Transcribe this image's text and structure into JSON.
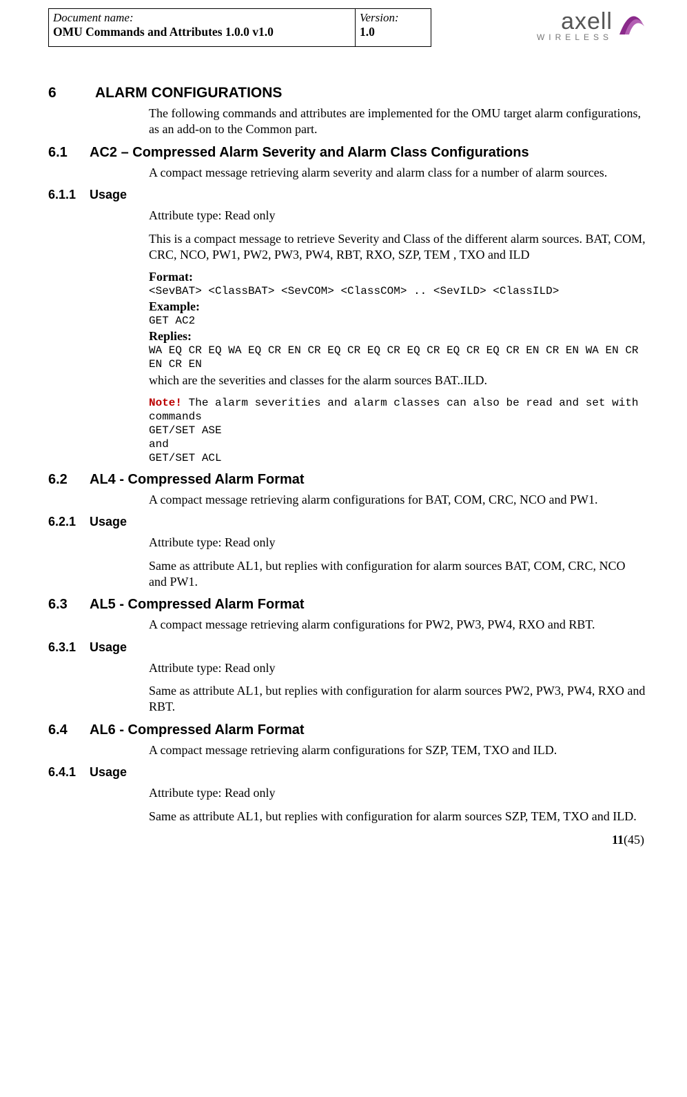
{
  "header": {
    "docLabel": "Document name:",
    "docValue": "OMU Commands and Attributes 1.0.0 v1.0",
    "verLabel": "Version:",
    "verValue": "1.0",
    "logoBrand": "axell",
    "logoSub": "WIRELESS"
  },
  "s6": {
    "num": "6",
    "title": "ALARM CONFIGURATIONS",
    "intro": "The following commands and attributes are implemented for the OMU target alarm configurations, as an add-on to the Common part."
  },
  "s61": {
    "num": "6.1",
    "title": "AC2 – Compressed Alarm Severity and Alarm Class Configurations",
    "intro": "A compact message retrieving alarm severity and alarm class for a number of alarm sources."
  },
  "s611": {
    "num": "6.1.1",
    "title": "Usage",
    "attr": "Attribute type: Read only",
    "desc": "This is a compact message to retrieve Severity and Class of the different alarm sources. BAT, COM, CRC, NCO, PW1, PW2, PW3, PW4, RBT, RXO, SZP, TEM , TXO and ILD",
    "formatLabel": "Format:",
    "format": "<SevBAT> <ClassBAT> <SevCOM> <ClassCOM> .. <SevILD> <ClassILD>",
    "exampleLabel": "Example:",
    "example": "GET AC2",
    "repliesLabel": "Replies:",
    "replies": "WA EQ CR EQ WA EQ CR EN CR EQ CR EQ CR EQ CR EQ CR EQ CR EN CR EN WA EN CR EN CR EN",
    "tail": "which are the severities and classes for the alarm sources BAT..ILD.",
    "noteLabel": "Note!",
    "noteBody": " The alarm severities and alarm classes can also be read and set with commands\nGET/SET ASE\nand\nGET/SET ACL"
  },
  "s62": {
    "num": "6.2",
    "title": "AL4 - Compressed Alarm Format",
    "intro": "A compact message retrieving alarm configurations for  BAT, COM, CRC, NCO and PW1."
  },
  "s621": {
    "num": "6.2.1",
    "title": "Usage",
    "attr": "Attribute type: Read only",
    "desc": "Same as attribute AL1, but replies with configuration for alarm sources BAT, COM, CRC, NCO and PW1."
  },
  "s63": {
    "num": "6.3",
    "title": "AL5 - Compressed Alarm Format",
    "intro": "A compact message retrieving alarm configurations for PW2, PW3, PW4, RXO and RBT."
  },
  "s631": {
    "num": "6.3.1",
    "title": "Usage",
    "attr": "Attribute type: Read only",
    "desc": "Same as attribute AL1, but replies with configuration for alarm sources PW2, PW3, PW4, RXO and RBT."
  },
  "s64": {
    "num": "6.4",
    "title": "AL6 - Compressed Alarm Format",
    "intro": "A compact message retrieving alarm configurations for  SZP, TEM, TXO and ILD."
  },
  "s641": {
    "num": "6.4.1",
    "title": "Usage",
    "attr": "Attribute type: Read only",
    "desc": "Same as attribute AL1, but replies with configuration for alarm sources SZP, TEM, TXO and ILD."
  },
  "footer": {
    "page": "11",
    "total": "(45)"
  }
}
